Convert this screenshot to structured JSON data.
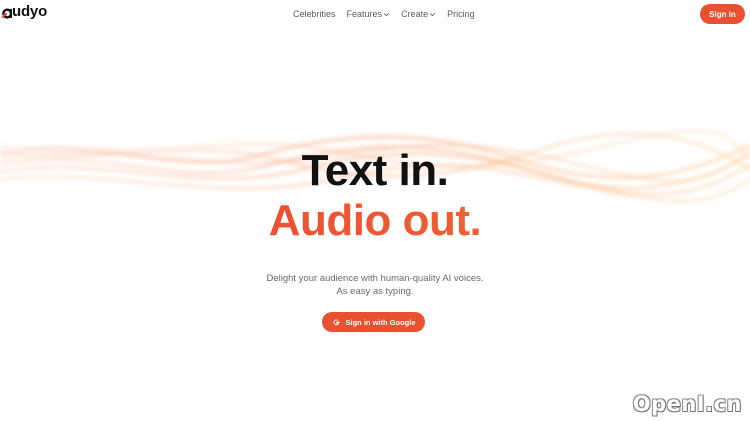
{
  "brand": {
    "name": "udyo",
    "accent": "#e8502f"
  },
  "nav": {
    "items": [
      {
        "label": "Celebrities",
        "has_dropdown": false
      },
      {
        "label": "Features",
        "has_dropdown": true
      },
      {
        "label": "Create",
        "has_dropdown": true
      },
      {
        "label": "Pricing",
        "has_dropdown": false
      }
    ],
    "signin_label": "Sign in"
  },
  "hero": {
    "line1": "Text in.",
    "line2": "Audio out.",
    "subtitle_line1": "Delight your audience with human-quality AI voices.",
    "subtitle_line2": "As easy as typing.",
    "cta_label": "Sign in with Google",
    "cta_icon": "google-icon"
  },
  "watermark": "OpenI.cn"
}
